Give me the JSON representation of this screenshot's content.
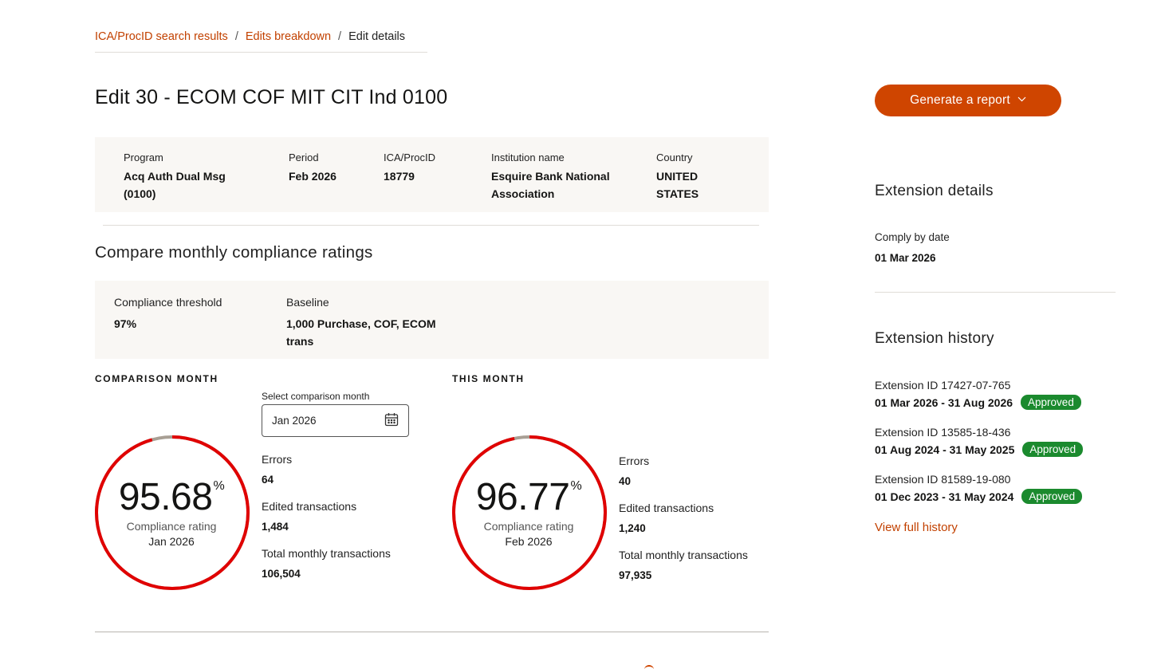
{
  "breadcrumb": {
    "items": [
      {
        "label": "ICA/ProcID search results"
      },
      {
        "label": "Edits breakdown"
      }
    ],
    "separator": "/",
    "current": "Edit details"
  },
  "page": {
    "title": "Edit 30 - ECOM COF MIT CIT Ind 0100"
  },
  "info": {
    "program_label": "Program",
    "program_value_line1": "Acq Auth Dual Msg",
    "program_value_line2": "(0100)",
    "period_label": "Period",
    "period_value": "Feb 2026",
    "ica_label": "ICA/ProcID",
    "ica_value": "18779",
    "institution_label": "Institution name",
    "institution_value_line1": "Esquire Bank National",
    "institution_value_line2": "Association",
    "country_label": "Country",
    "country_value_line1": "UNITED",
    "country_value_line2": "STATES"
  },
  "compare": {
    "title": "Compare monthly compliance ratings",
    "threshold_label": "Compliance threshold",
    "threshold_value": "97%",
    "baseline_label": "Baseline",
    "baseline_value_line1": "1,000 Purchase, COF, ECOM",
    "baseline_value_line2": "trans"
  },
  "comparison_month": {
    "heading": "COMPARISON MONTH",
    "select_label": "Select comparison month",
    "select_value": "Jan 2026",
    "rating": "95.68",
    "rating_fraction": 0.9568,
    "percent_sign": "%",
    "caption": "Compliance rating",
    "month": "Jan 2026",
    "errors_label": "Errors",
    "errors_value": "64",
    "edited_label": "Edited transactions",
    "edited_value": "1,484",
    "total_label": "Total monthly transactions",
    "total_value": "106,504"
  },
  "this_month": {
    "heading": "THIS MONTH",
    "rating": "96.77",
    "rating_fraction": 0.9677,
    "percent_sign": "%",
    "caption": "Compliance rating",
    "month": "Feb 2026",
    "errors_label": "Errors",
    "errors_value": "40",
    "edited_label": "Edited transactions",
    "edited_value": "1,240",
    "total_label": "Total monthly transactions",
    "total_value": "97,935"
  },
  "actions": {
    "report_label": "Generate a report",
    "report_icon": "chevron-down-icon"
  },
  "extension_details": {
    "title": "Extension details",
    "comply_label": "Comply by date",
    "comply_value": "01 Mar 2026"
  },
  "extension_history": {
    "title": "Extension history",
    "items": [
      {
        "id": "Extension ID 17427-07-765",
        "dates": "01 Mar 2026 - 31 Aug 2026",
        "status": "Approved"
      },
      {
        "id": "Extension ID 13585-18-436",
        "dates": "01 Aug 2024 - 31 May 2025",
        "status": "Approved"
      },
      {
        "id": "Extension ID 81589-19-080",
        "dates": "01 Dec 2023 - 31 May 2024",
        "status": "Approved"
      }
    ],
    "view_all_label": "View full history"
  },
  "colors": {
    "brand": "#cf4500",
    "link": "#c24100",
    "gauge_fill": "#e00000",
    "gauge_remainder": "#a89f94",
    "approved": "#1b8a2e",
    "panel_bg": "#f9f7f4"
  }
}
